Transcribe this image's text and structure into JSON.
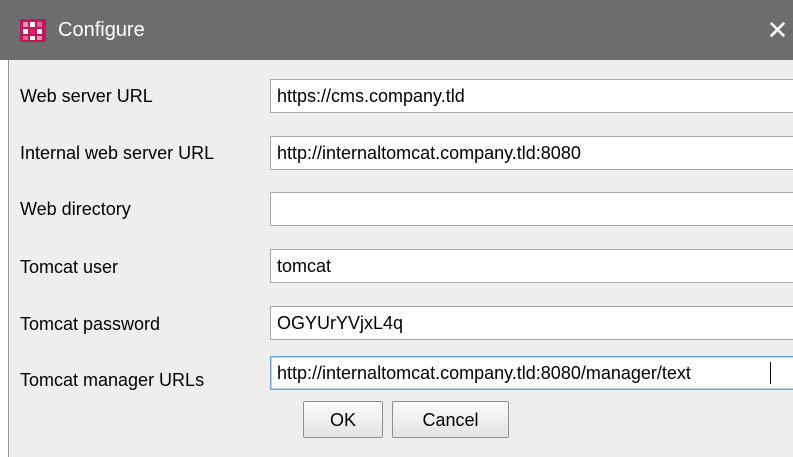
{
  "window": {
    "title": "Configure",
    "close_glyph": "✕",
    "accent_color": "#6d6d6d",
    "app_icon": "app-logo-icon"
  },
  "form": {
    "fields": [
      {
        "label": "Web server URL",
        "value": "https://cms.company.tld"
      },
      {
        "label": "Internal web server URL",
        "value": "http://internaltomcat.company.tld:8080"
      },
      {
        "label": "Web directory",
        "value": ""
      },
      {
        "label": "Tomcat user",
        "value": "tomcat"
      },
      {
        "label": "Tomcat password",
        "value": "OGYUrYVjxL4q"
      },
      {
        "label": "Tomcat manager URLs",
        "value": "http://internaltomcat.company.tld:8080/manager/text"
      }
    ]
  },
  "buttons": {
    "ok_label": "OK",
    "cancel_label": "Cancel"
  }
}
